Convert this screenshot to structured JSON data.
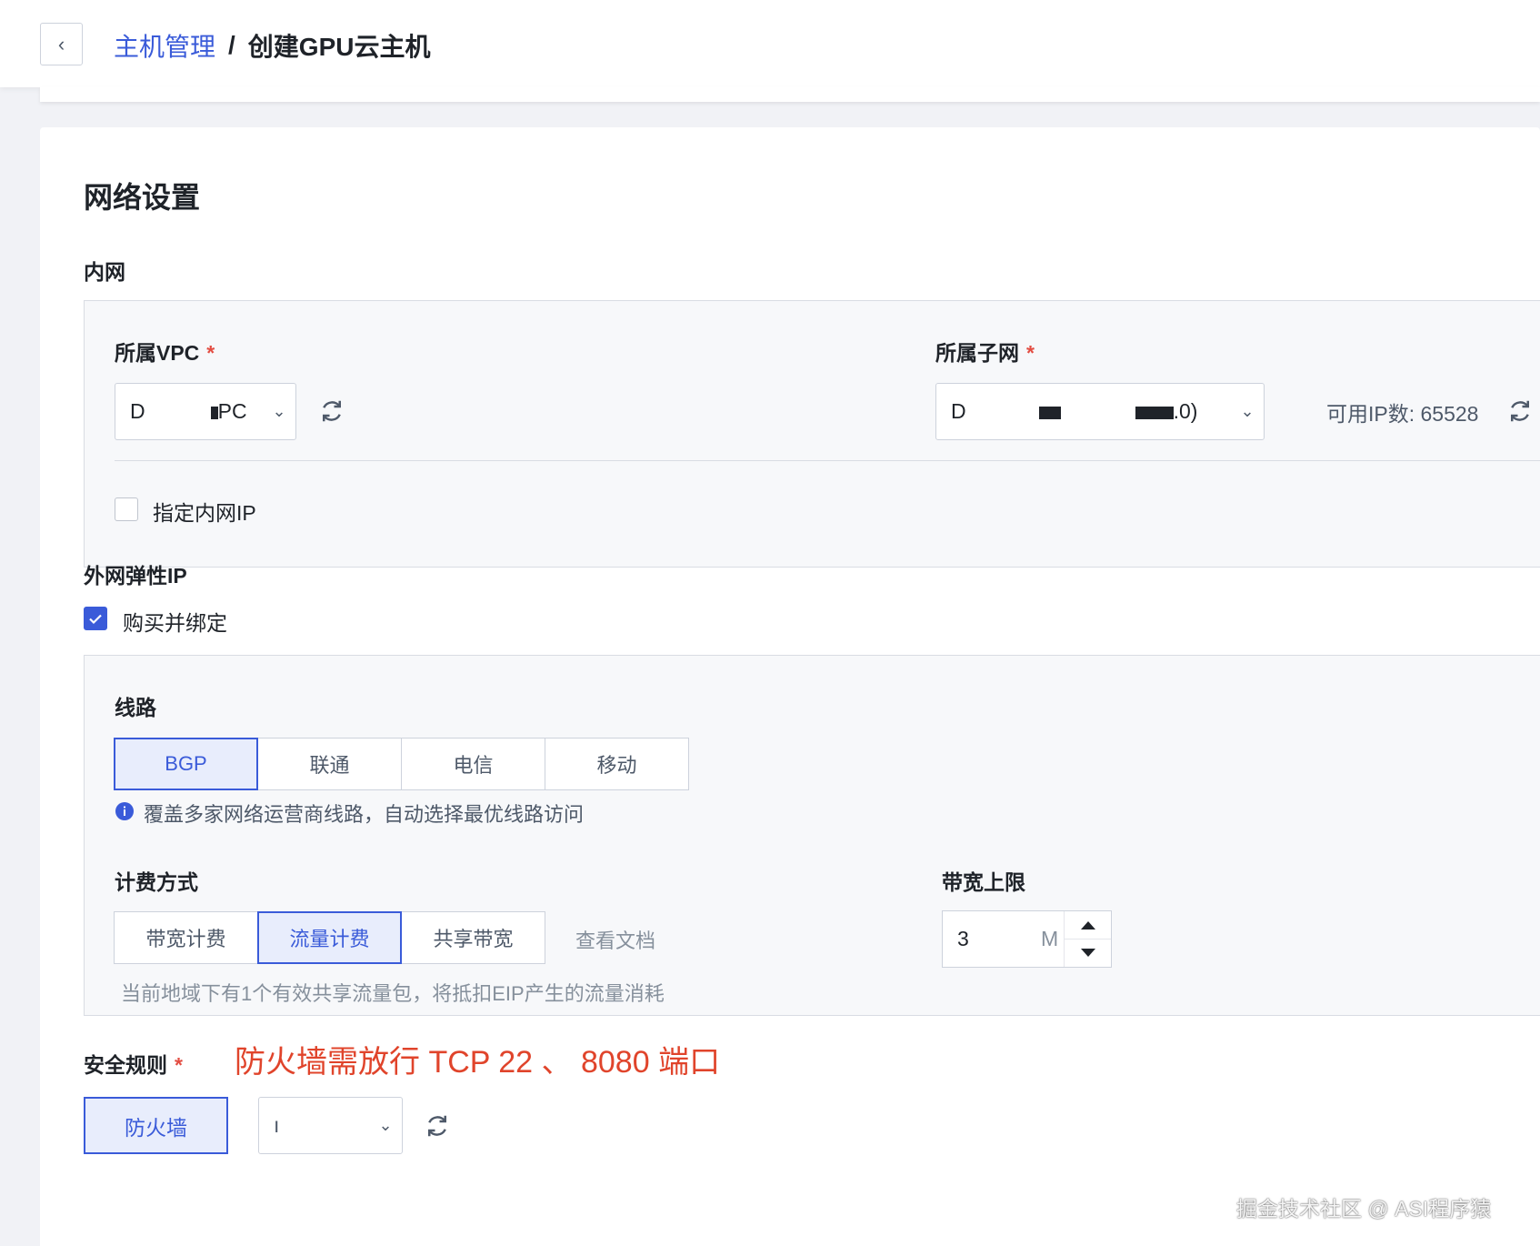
{
  "header": {
    "back_icon": "chevron-left-icon",
    "breadcrumb_parent": "主机管理",
    "breadcrumb_sep": "/",
    "breadcrumb_current": "创建GPU云主机"
  },
  "network": {
    "title": "网络设置",
    "intranet": {
      "title": "内网",
      "vpc_label": "所属VPC",
      "vpc_value_prefix": "D",
      "vpc_value_suffix": "PC",
      "subnet_label": "所属子网",
      "subnet_value_prefix": "D",
      "subnet_value_suffix": ".0)",
      "available_ip": "可用IP数: 65528",
      "specify_ip_label": "指定内网IP",
      "specify_ip_checked": false
    },
    "eip": {
      "title": "外网弹性IP",
      "buy_bind_label": "购买并绑定",
      "buy_bind_checked": true,
      "line_label": "线路",
      "lines": [
        "BGP",
        "联通",
        "电信",
        "移动"
      ],
      "line_selected": "BGP",
      "line_hint": "覆盖多家网络运营商线路，自动选择最优线路访问",
      "billing_label": "计费方式",
      "billing_options": [
        "带宽计费",
        "流量计费",
        "共享带宽"
      ],
      "billing_selected": "流量计费",
      "doc_link": "查看文档",
      "billing_note": "当前地域下有1个有效共享流量包，将抵扣EIP产生的流量消耗",
      "bandwidth_label": "带宽上限",
      "bandwidth_value": "3",
      "bandwidth_unit": "M"
    },
    "security": {
      "label": "安全规则",
      "firewall_button": "防火墙",
      "firewall_select_value": "ı"
    }
  },
  "annotation": "防火墙需放行 TCP 22 、 8080 端口",
  "watermark": "掘金技术社区 @ ASI程序猿",
  "colors": {
    "accent": "#3a5bd9",
    "required": "#e34d42",
    "annotation": "#e0442b"
  }
}
